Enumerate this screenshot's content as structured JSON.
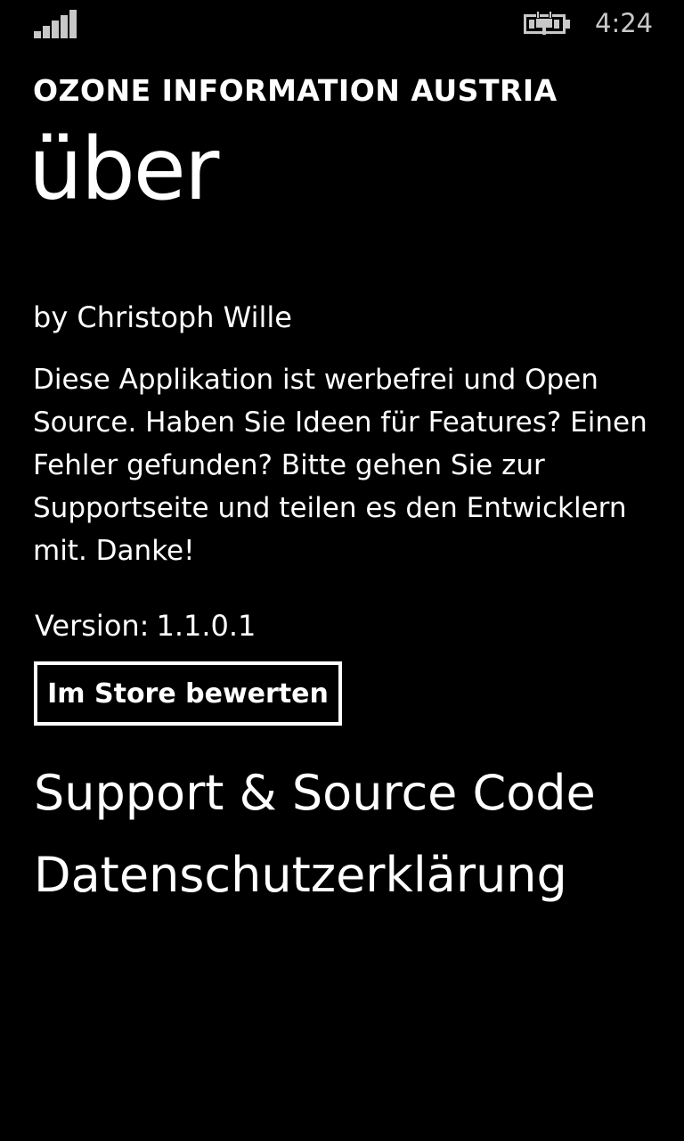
{
  "status_bar": {
    "signal_icon": "signal-strength-icon",
    "battery_icon": "battery-charging-icon",
    "time": "4:24",
    "status_color": "#c8c8c8"
  },
  "header": {
    "app_title": "OZONE INFORMATION AUSTRIA",
    "page_title": "über"
  },
  "content": {
    "author": "by Christoph Wille",
    "description": "Diese Applikation ist werbefrei und Open Source. Haben Sie Ideen für Features? Einen Fehler gefunden? Bitte gehen Sie zur Supportseite und teilen es den Entwicklern mit. Danke!",
    "version_label": "Version:",
    "version_value": "1.1.0.1",
    "rate_button_label": "Im Store bewerten"
  },
  "links": {
    "support": "Support & Source Code",
    "privacy": "Datenschutzerklärung"
  },
  "colors": {
    "background": "#000000",
    "foreground": "#ffffff"
  }
}
